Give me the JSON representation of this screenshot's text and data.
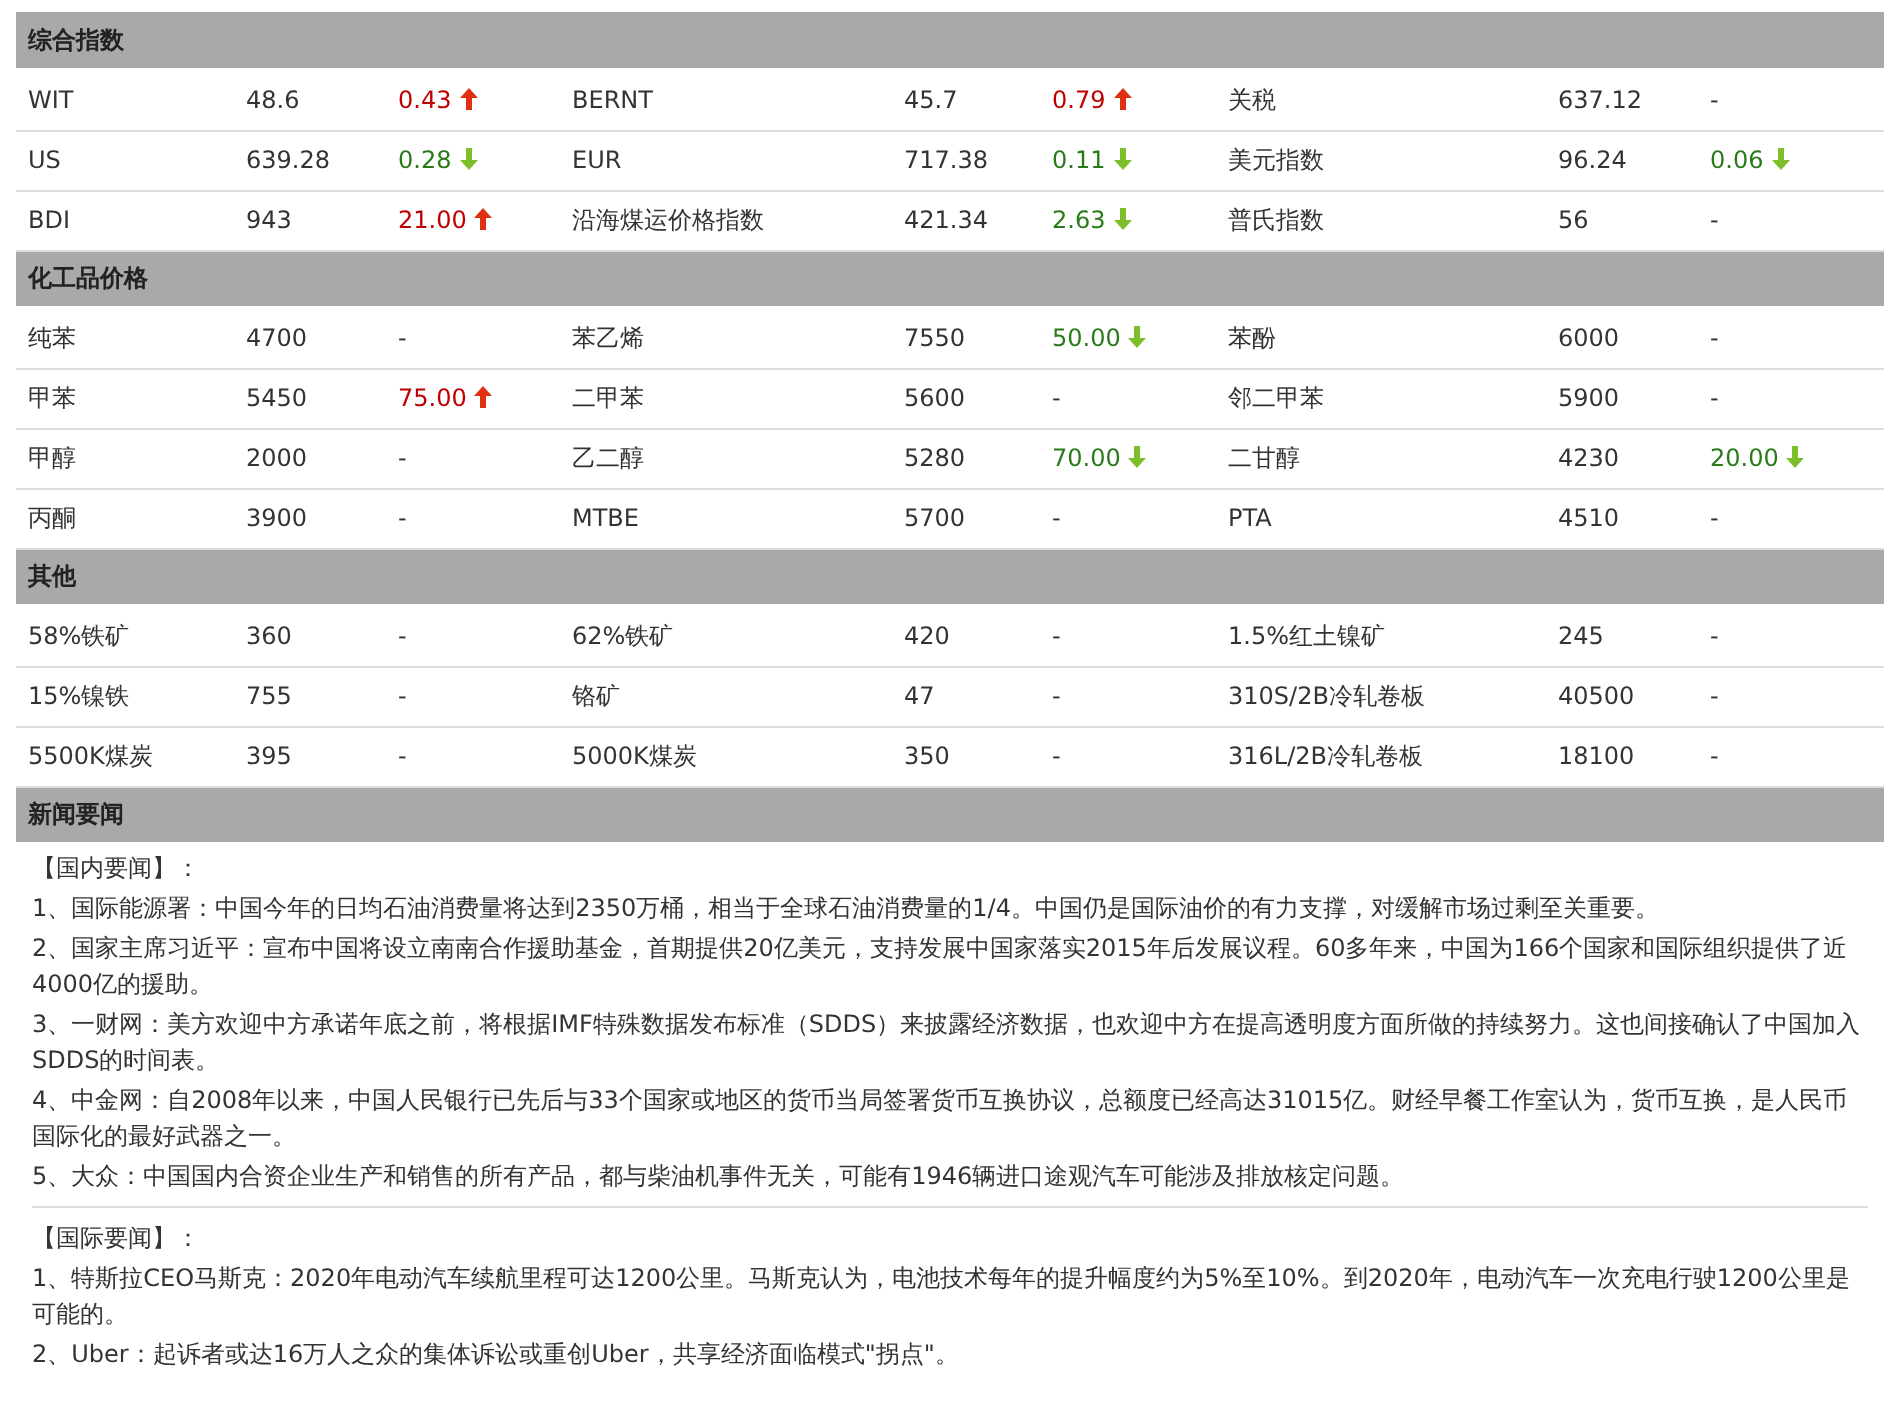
{
  "sections": [
    {
      "title": "综合指数",
      "rows": [
        [
          {
            "name": "WIT",
            "value": "48.6",
            "change": "0.43",
            "up": true,
            "down": false
          },
          {
            "name": "BERNT",
            "value": "45.7",
            "change": "0.79",
            "up": true,
            "down": false
          },
          {
            "name": "关税",
            "value": "637.12",
            "change": "-",
            "up": false,
            "down": false
          }
        ],
        [
          {
            "name": "US",
            "value": "639.28",
            "change": "0.28",
            "up": false,
            "down": true
          },
          {
            "name": "EUR",
            "value": "717.38",
            "change": "0.11",
            "up": false,
            "down": true
          },
          {
            "name": "美元指数",
            "value": "96.24",
            "change": "0.06",
            "up": false,
            "down": true
          }
        ],
        [
          {
            "name": "BDI",
            "value": "943",
            "change": "21.00",
            "up": true,
            "down": false
          },
          {
            "name": "沿海煤运价格指数",
            "value": "421.34",
            "change": "2.63",
            "up": false,
            "down": true
          },
          {
            "name": "普氏指数",
            "value": "56",
            "change": "-",
            "up": false,
            "down": false
          }
        ]
      ]
    },
    {
      "title": "化工品价格",
      "rows": [
        [
          {
            "name": "纯苯",
            "value": "4700",
            "change": "-",
            "up": false,
            "down": false
          },
          {
            "name": "苯乙烯",
            "value": "7550",
            "change": "50.00",
            "up": false,
            "down": true
          },
          {
            "name": "苯酚",
            "value": "6000",
            "change": "-",
            "up": false,
            "down": false
          }
        ],
        [
          {
            "name": "甲苯",
            "value": "5450",
            "change": "75.00",
            "up": true,
            "down": false
          },
          {
            "name": "二甲苯",
            "value": "5600",
            "change": "-",
            "up": false,
            "down": false
          },
          {
            "name": "邻二甲苯",
            "value": "5900",
            "change": "-",
            "up": false,
            "down": false
          }
        ],
        [
          {
            "name": "甲醇",
            "value": "2000",
            "change": "-",
            "up": false,
            "down": false
          },
          {
            "name": "乙二醇",
            "value": "5280",
            "change": "70.00",
            "up": false,
            "down": true
          },
          {
            "name": "二甘醇",
            "value": "4230",
            "change": "20.00",
            "up": false,
            "down": true
          }
        ],
        [
          {
            "name": "丙酮",
            "value": "3900",
            "change": "-",
            "up": false,
            "down": false
          },
          {
            "name": "MTBE",
            "value": "5700",
            "change": "-",
            "up": false,
            "down": false
          },
          {
            "name": "PTA",
            "value": "4510",
            "change": "-",
            "up": false,
            "down": false
          }
        ]
      ]
    },
    {
      "title": "其他",
      "rows": [
        [
          {
            "name": "58%铁矿",
            "value": "360",
            "change": "-",
            "up": false,
            "down": false
          },
          {
            "name": "62%铁矿",
            "value": "420",
            "change": "-",
            "up": false,
            "down": false
          },
          {
            "name": "1.5%红土镍矿",
            "value": "245",
            "change": "-",
            "up": false,
            "down": false
          }
        ],
        [
          {
            "name": "15%镍铁",
            "value": "755",
            "change": "-",
            "up": false,
            "down": false
          },
          {
            "name": "铬矿",
            "value": "47",
            "change": "-",
            "up": false,
            "down": false
          },
          {
            "name": "310S/2B冷轧卷板",
            "value": "40500",
            "change": "-",
            "up": false,
            "down": false
          }
        ],
        [
          {
            "name": "5500K煤炭",
            "value": "395",
            "change": "-",
            "up": false,
            "down": false
          },
          {
            "name": "5000K煤炭",
            "value": "350",
            "change": "-",
            "up": false,
            "down": false
          },
          {
            "name": "316L/2B冷轧卷板",
            "value": "18100",
            "change": "-",
            "up": false,
            "down": false
          }
        ]
      ]
    }
  ],
  "news": {
    "title": "新闻要闻",
    "groups": [
      {
        "heading": "【国内要闻】：",
        "items": [
          "1、国际能源署：中国今年的日均石油消费量将达到2350万桶，相当于全球石油消费量的1/4。中国仍是国际油价的有力支撑，对缓解市场过剩至关重要。",
          "2、国家主席习近平：宣布中国将设立南南合作援助基金，首期提供20亿美元，支持发展中国家落实2015年后发展议程。60多年来，中国为166个国家和国际组织提供了近4000亿的援助。",
          "3、一财网：美方欢迎中方承诺年底之前，将根据IMF特殊数据发布标准（SDDS）来披露经济数据，也欢迎中方在提高透明度方面所做的持续努力。这也间接确认了中国加入SDDS的时间表。",
          "4、中金网：自2008年以来，中国人民银行已先后与33个国家或地区的货币当局签署货币互换协议，总额度已经高达31015亿。财经早餐工作室认为，货币互换，是人民币国际化的最好武器之一。",
          "5、大众：中国国内合资企业生产和销售的所有产品，都与柴油机事件无关，可能有1946辆进口途观汽车可能涉及排放核定问题。"
        ]
      },
      {
        "heading": "【国际要闻】：",
        "items": [
          "1、特斯拉CEO马斯克：2020年电动汽车续航里程可达1200公里。马斯克认为，电池技术每年的提升幅度约为5%至10%。到2020年，电动汽车一次充电行驶1200公里是可能的。",
          "2、Uber：起诉者或达16万人之众的集体诉讼或重创Uber，共享经济面临模式\"拐点\"。"
        ]
      }
    ]
  }
}
